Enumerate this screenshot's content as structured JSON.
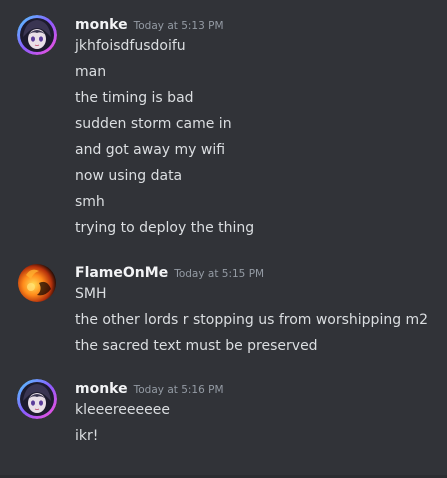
{
  "messages": [
    {
      "author": "monke",
      "timestamp": "Today at 5:13 PM",
      "avatar": "anime-girl-avatar",
      "lines": [
        "jkhfoisdfusdoifu",
        "man",
        "the timing is bad",
        "sudden storm came in",
        "and got away my wifi",
        "now using data",
        "smh",
        "trying to deploy the thing"
      ]
    },
    {
      "author": "FlameOnMe",
      "timestamp": "Today at 5:15 PM",
      "avatar": "fireball-avatar",
      "lines": [
        "SMH",
        "the other lords r stopping us from worshipping m2",
        "the sacred text must be preserved"
      ]
    },
    {
      "author": "monke",
      "timestamp": "Today at 5:16 PM",
      "avatar": "anime-girl-avatar",
      "lines": [
        "kleeereeeeee",
        "ikr!"
      ]
    }
  ],
  "colors": {
    "background": "#313338",
    "username": "#f2f3f5",
    "timestamp": "#949ba4",
    "message_text": "#dbdee1"
  }
}
